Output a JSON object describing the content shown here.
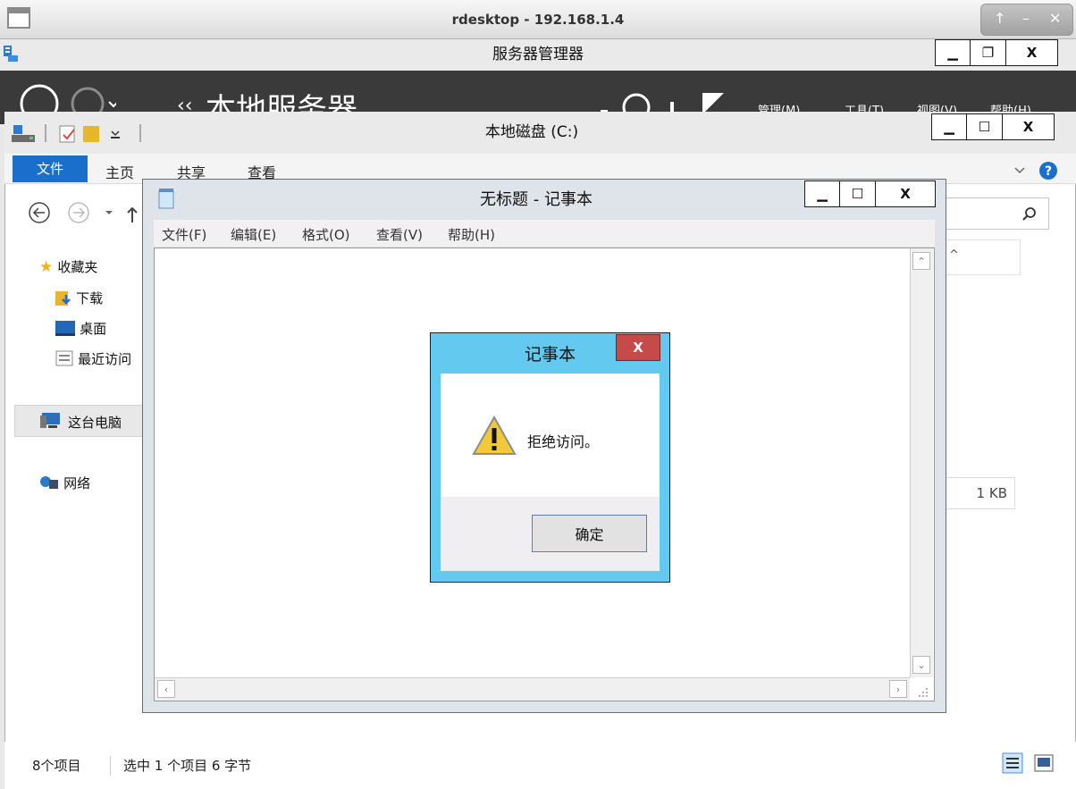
{
  "rdesktop": {
    "title": "rdesktop - 192.168.1.4",
    "up_glyph": "↑",
    "min_glyph": "–",
    "close_glyph": "✕"
  },
  "server_manager": {
    "title": "服务器管理器",
    "breadcrumb_arrows": "‹‹",
    "header_title": "本地服务器",
    "menus": [
      "管理(M)",
      "工具(T)",
      "视图(V)",
      "帮助(H)"
    ],
    "controls": {
      "minimize": "▁",
      "restore": "❐",
      "close": "X"
    }
  },
  "explorer": {
    "title": "本地磁盘 (C:)",
    "tabs": {
      "file": "文件",
      "home": "主页",
      "share": "共享",
      "view": "查看"
    },
    "nav": {
      "favorites": "收藏夹",
      "downloads": "下载",
      "desktop": "桌面",
      "recent": "最近访问",
      "this_pc": "这台电脑",
      "network": "网络"
    },
    "column_glyph": "^",
    "file_size": "1 KB",
    "status": {
      "item_count": "8个项目",
      "selected": "选中 1 个项目  6 字节"
    },
    "controls": {
      "minimize": "▁",
      "maximize": "☐",
      "close": "X"
    }
  },
  "notepad": {
    "title": "无标题 - 记事本",
    "menus": {
      "file": "文件(F)",
      "edit": "编辑(E)",
      "format": "格式(O)",
      "view": "查看(V)",
      "help": "帮助(H)"
    },
    "content": "",
    "controls": {
      "minimize": "▁",
      "maximize": "☐",
      "close": "X"
    }
  },
  "dialog": {
    "title": "记事本",
    "message": "拒绝访问。",
    "ok_label": "确定",
    "close_label": "X"
  },
  "colors": {
    "ribbon_file_tab": "#1a6fcc",
    "dialog_frame": "#63c9ef",
    "dialog_close": "#c74a4a",
    "server_manager_header": "#3a3a3a"
  }
}
